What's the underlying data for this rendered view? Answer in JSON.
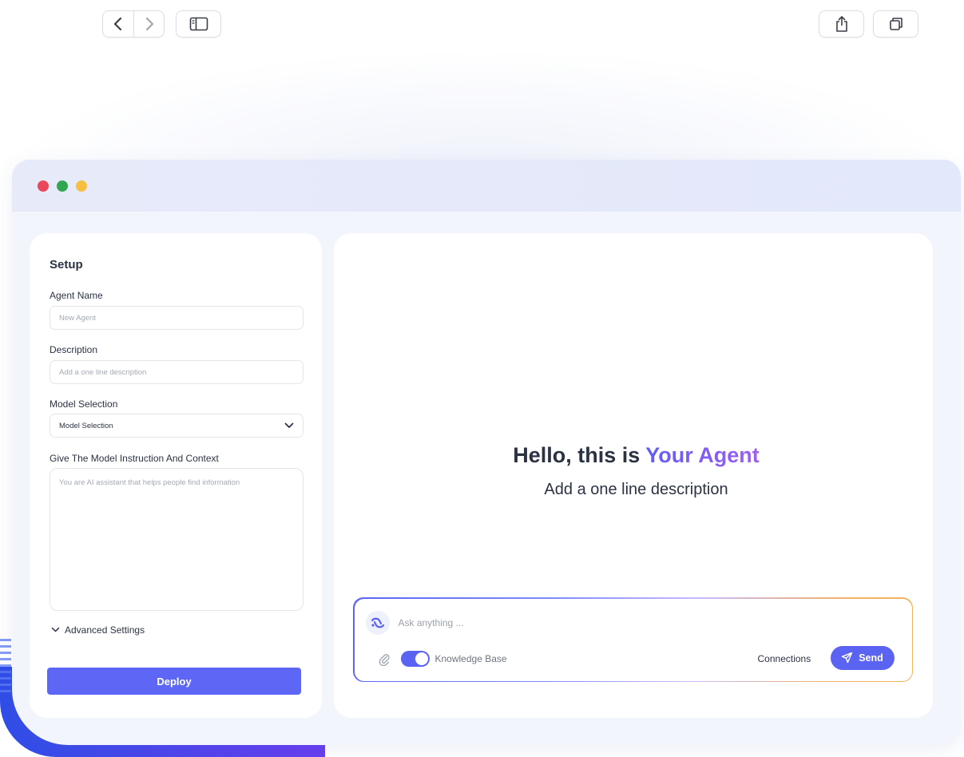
{
  "toolbar": {
    "back_icon": "chevron-left-icon",
    "forward_icon": "chevron-right-icon",
    "sidebar_icon": "sidebar-toggle-icon",
    "share_icon": "share-icon",
    "tabs_icon": "tabs-overview-icon"
  },
  "window": {
    "controls": [
      "close",
      "maximize",
      "minimize"
    ],
    "control_colors": {
      "close": "#e9475a",
      "maximize": "#33a654",
      "minimize": "#f6bf41"
    }
  },
  "setup": {
    "title": "Setup",
    "agent_name": {
      "label": "Agent Name",
      "placeholder": "New Agent",
      "value": ""
    },
    "description": {
      "label": "Description",
      "placeholder": "Add a one line description",
      "value": ""
    },
    "model": {
      "label": "Model Selection",
      "selected": "Model Selection"
    },
    "instructions": {
      "label": "Give The Model Instruction And Context",
      "placeholder": "You are AI assistant that helps people find information",
      "value": ""
    },
    "advanced_label": "Advanced Settings",
    "deploy_label": "Deploy"
  },
  "chat": {
    "greeting_prefix": "Hello, this is ",
    "agent_name": "Your Agent",
    "subtitle": "Add a one line description",
    "composer": {
      "placeholder": "Ask anything ...",
      "knowledge_base_label": "Knowledge Base",
      "knowledge_base_enabled": true,
      "connections_label": "Connections",
      "send_label": "Send"
    }
  },
  "colors": {
    "accent": "#5b63f2",
    "deploy": "#5e67f5",
    "text": "#2b3343",
    "muted": "#a3a9b4"
  }
}
